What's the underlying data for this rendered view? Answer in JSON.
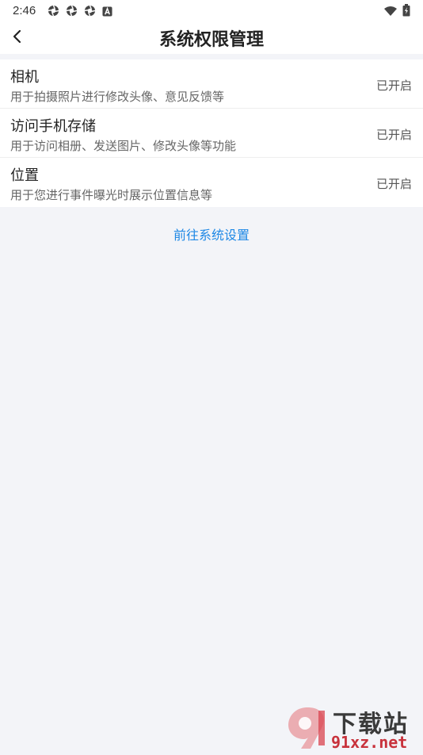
{
  "status_bar": {
    "time": "2:46",
    "left_icons": [
      "aperture-icon",
      "aperture-icon",
      "aperture-icon",
      "a-square-icon"
    ],
    "right_icons": [
      "wifi-icon",
      "battery-charging-icon"
    ]
  },
  "header": {
    "back_icon": "chevron-left-icon",
    "title": "系统权限管理"
  },
  "permissions": [
    {
      "title": "相机",
      "desc": "用于拍摄照片进行修改头像、意见反馈等",
      "status": "已开启"
    },
    {
      "title": "访问手机存储",
      "desc": "用于访问相册、发送图片、修改头像等功能",
      "status": "已开启"
    },
    {
      "title": "位置",
      "desc": "用于您进行事件曝光时展示位置信息等",
      "status": "已开启"
    }
  ],
  "settings_link": "前往系统设置",
  "watermark": {
    "title": "下载站",
    "url": "91xz.net"
  },
  "colors": {
    "page_bg": "#f3f4f8",
    "link": "#1e88e5",
    "watermark_red": "#c8323c"
  }
}
